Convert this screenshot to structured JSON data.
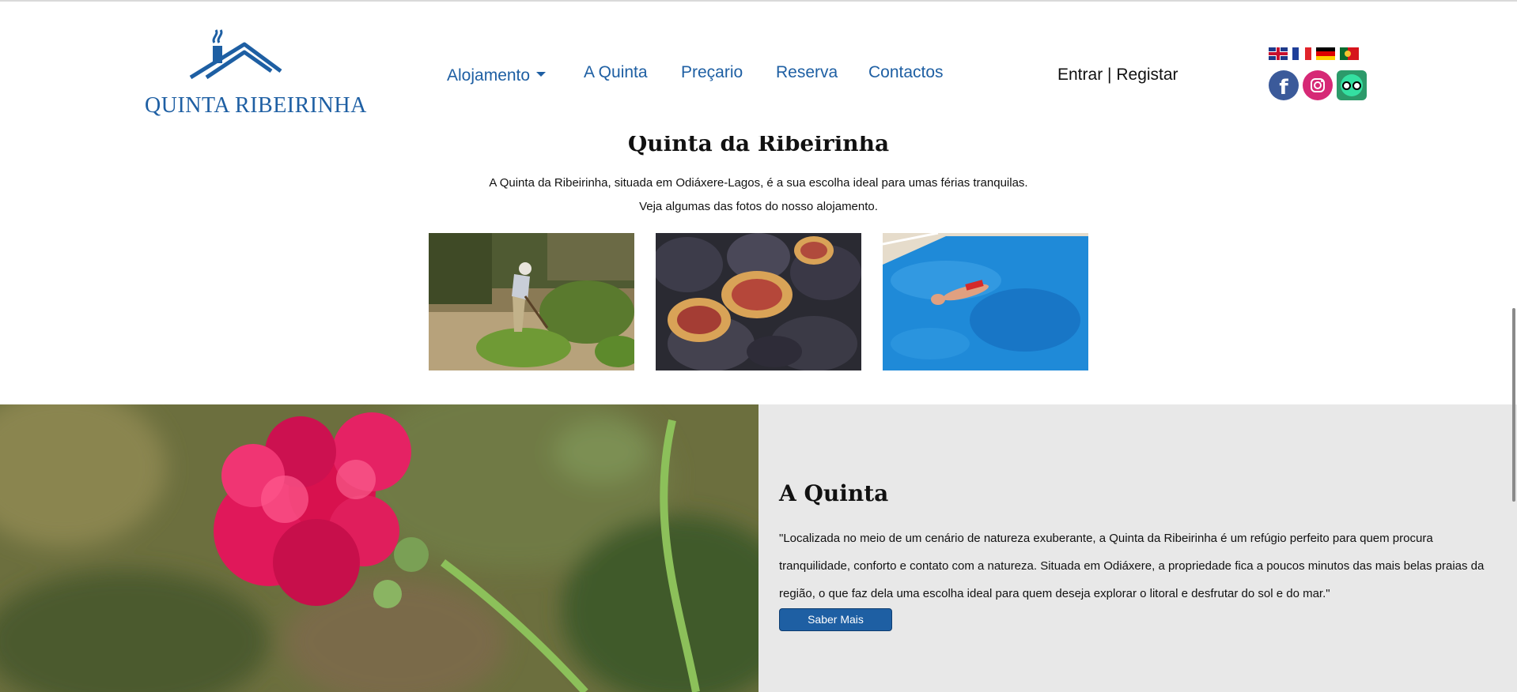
{
  "brand": {
    "name": "QUINTA RIBEIRINHA",
    "color": "#1e5fa3"
  },
  "nav": {
    "items": [
      {
        "label": "Alojamento",
        "has_dropdown": true
      },
      {
        "label": "A Quinta"
      },
      {
        "label": "Preçario"
      },
      {
        "label": "Reserva"
      },
      {
        "label": "Contactos"
      }
    ]
  },
  "auth": {
    "login": "Entrar",
    "separator": "|",
    "register": "Registar"
  },
  "languages": [
    "english-flag",
    "french-flag",
    "german-flag",
    "portuguese-flag"
  ],
  "socials": [
    "facebook-icon",
    "instagram-icon",
    "tripadvisor-icon"
  ],
  "intro": {
    "title": "Quinta da Ribeirinha",
    "line1": "A Quinta da Ribeirinha, situada em Odiáxere-Lagos, é a sua escolha ideal para umas férias tranquilas.",
    "line2": "Veja algumas das fotos do nosso alojamento."
  },
  "photos": [
    "gardener-photo",
    "figs-photo",
    "swimming-pool-photo"
  ],
  "feature": {
    "title": "A Quinta",
    "text": "\"Localizada no meio de um cenário de natureza exuberante, a Quinta da Ribeirinha é um refúgio perfeito para quem procura tranquilidade, conforto e contato com a natureza. Situada em Odiáxere, a propriedade fica a poucos minutos das mais belas praias da região, o que faz dela uma escolha ideal para quem deseja explorar o litoral e desfrutar do sol e do mar.\"",
    "button": "Saber Mais",
    "panel_color": "#e8e8e8"
  }
}
